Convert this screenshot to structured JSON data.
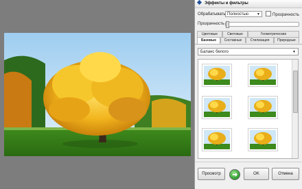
{
  "panel": {
    "title": "Эффекты и фильтры",
    "process_label": "Обрабатывать",
    "process_value": "Полностью",
    "transparency_checkbox_label": "Прозрачность",
    "transparency_label": "Прозрачность",
    "transparency_value": 0
  },
  "tabs": {
    "row1": [
      "Цветовые",
      "Световые",
      "Геометрические"
    ],
    "row2": [
      "Базовые",
      "Составные",
      "Стилизация",
      "Природные"
    ],
    "active": "Базовые"
  },
  "effect_select": {
    "value": "Баланс белого"
  },
  "thumbnails": {
    "count": 6
  },
  "buttons": {
    "preview": "Просмотр",
    "ok": "OK",
    "cancel": "Отмена"
  },
  "colors": {
    "accent": "#1e4f9a",
    "apply_icon": "#3aa63a"
  }
}
